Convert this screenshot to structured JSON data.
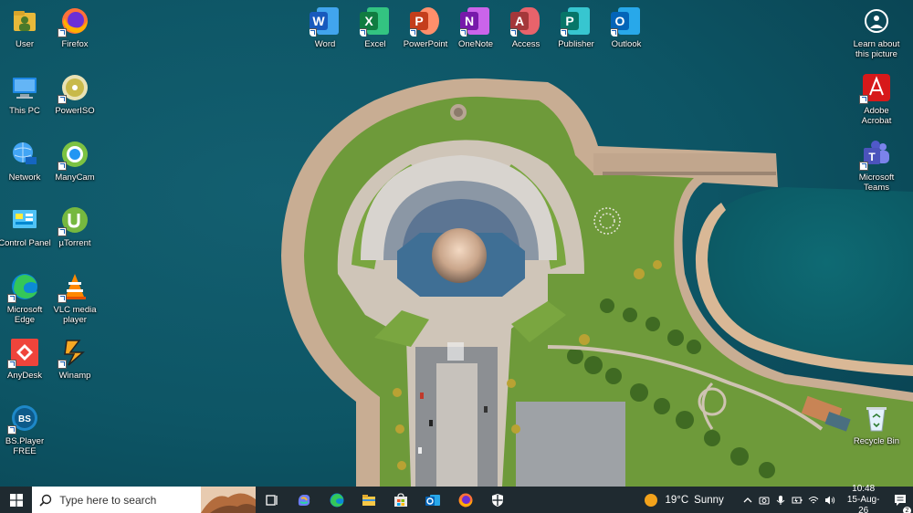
{
  "desktop": {
    "left_icons": [
      {
        "label": "User",
        "icon": "user-folder-icon"
      },
      {
        "label": "Firefox",
        "icon": "firefox-icon"
      },
      {
        "label": "This PC",
        "icon": "this-pc-icon"
      },
      {
        "label": "PowerISO",
        "icon": "poweriso-icon"
      },
      {
        "label": "Network",
        "icon": "network-icon"
      },
      {
        "label": "ManyCam",
        "icon": "manycam-icon"
      },
      {
        "label": "Control Panel",
        "icon": "control-panel-icon"
      },
      {
        "label": "µTorrent",
        "icon": "utorrent-icon"
      },
      {
        "label": "Microsoft Edge",
        "icon": "edge-icon"
      },
      {
        "label": "VLC media player",
        "icon": "vlc-icon"
      },
      {
        "label": "AnyDesk",
        "icon": "anydesk-icon"
      },
      {
        "label": "Winamp",
        "icon": "winamp-icon"
      },
      {
        "label": "BS.Player FREE",
        "icon": "bsplayer-icon"
      }
    ],
    "office_icons": [
      {
        "label": "Word",
        "letter": "W",
        "color": "#185abd",
        "bg": "#41a5ee"
      },
      {
        "label": "Excel",
        "letter": "X",
        "color": "#107c41",
        "bg": "#33c481"
      },
      {
        "label": "PowerPoint",
        "letter": "P",
        "color": "#c43e1c",
        "bg": "#ff8f6b"
      },
      {
        "label": "OneNote",
        "letter": "N",
        "color": "#7719aa",
        "bg": "#ca64ea"
      },
      {
        "label": "Access",
        "letter": "A",
        "color": "#a4373a",
        "bg": "#e8636b"
      },
      {
        "label": "Publisher",
        "letter": "P",
        "color": "#077568",
        "bg": "#37c6d0"
      },
      {
        "label": "Outlook",
        "letter": "O",
        "color": "#0364b8",
        "bg": "#28a8ea"
      }
    ],
    "right_icons": [
      {
        "label": "Learn about this picture",
        "icon": "learn-picture-icon"
      },
      {
        "label": "Adobe Acrobat",
        "icon": "adobe-acrobat-icon"
      },
      {
        "label": "Microsoft Teams",
        "icon": "teams-icon"
      },
      {
        "label": "Recycle Bin",
        "icon": "recycle-bin-icon"
      }
    ]
  },
  "taskbar": {
    "search_placeholder": "Type here to search",
    "apps": [
      "task-view-icon",
      "copilot-icon",
      "edge-icon",
      "file-explorer-icon",
      "microsoft-store-icon",
      "outlook-icon",
      "firefox-icon",
      "security-icon"
    ],
    "weather": {
      "temp": "19°C",
      "condition": "Sunny"
    },
    "clock": {
      "time": "10:48",
      "date": "15-Aug-26"
    },
    "notification_count": "2"
  },
  "colors": {
    "water": "#0d5667",
    "taskbar": "#1f2a30",
    "grass": "#6e9a3a",
    "path": "#cdb59a"
  }
}
